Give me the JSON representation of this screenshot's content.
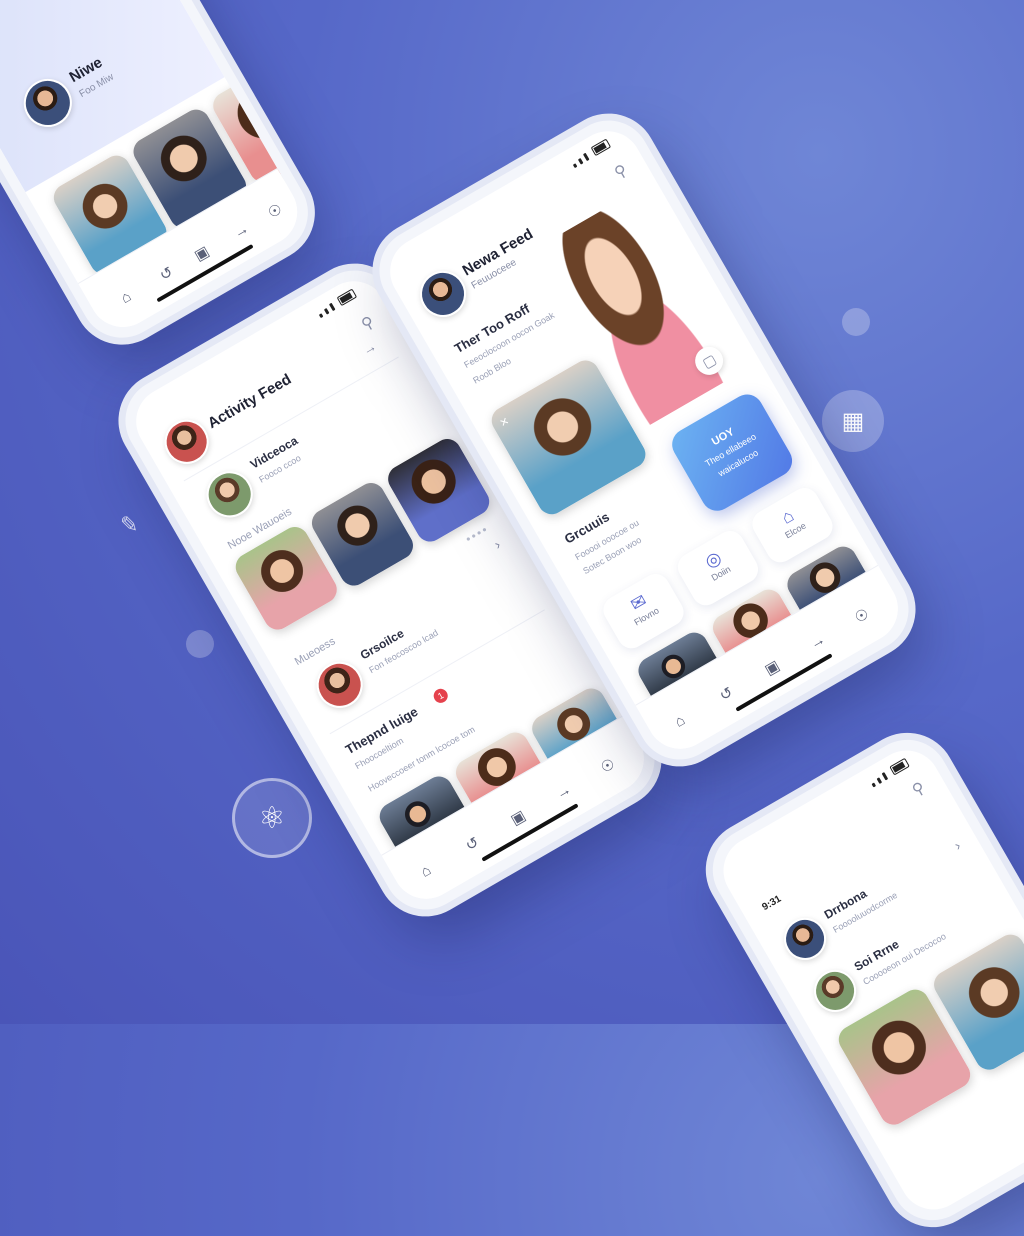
{
  "phone_top_left": {
    "title": "Niwe",
    "subtitle": "Foo Miw"
  },
  "phone_left": {
    "title": "Activity Feed",
    "sections": [
      {
        "title": "Vidceoca",
        "subtitle": "Fooco ccoo"
      },
      {
        "title": "Nooe Wauoeis"
      },
      {
        "title": "Mueoess"
      },
      {
        "title": "Grsoilce",
        "subtitle": "Fon feocoscoo lcad"
      },
      {
        "title": "Thepnd luige",
        "subtitle": "Fhoocoeltiom"
      },
      {
        "muted": "Hooveccoeer tonm lcocoe tom"
      }
    ],
    "badge_count": "1"
  },
  "phone_center": {
    "title": "Newa Feed",
    "subtitle": "Feuuoceee",
    "headline": "Ther Too Roff",
    "headline_sub": "Feeoclocoon oocon Goak",
    "headline_sub2": "Roob Bloo",
    "groups_title": "Grcuuis",
    "groups_sub": "Fooooi ooocoe ou",
    "groups_sub2": "Sotec Boon woo",
    "blue_card": [
      "UOY",
      "Theo ellabeeo",
      "waicalucoo"
    ],
    "tiles": [
      "Flovno",
      "Doiin",
      "Elcoe"
    ]
  },
  "phone_bottom_right": {
    "status_left": "9:31",
    "rows": [
      {
        "title": "Drrbona",
        "subtitle": "Fooooluuodcorme"
      },
      {
        "title": "Soi Rrne",
        "subtitle": "Cooooeon oui Decocoo"
      }
    ]
  },
  "nav_icons": [
    "home-icon",
    "repeat-icon",
    "share-icon",
    "arrow-icon",
    "profile-icon"
  ]
}
